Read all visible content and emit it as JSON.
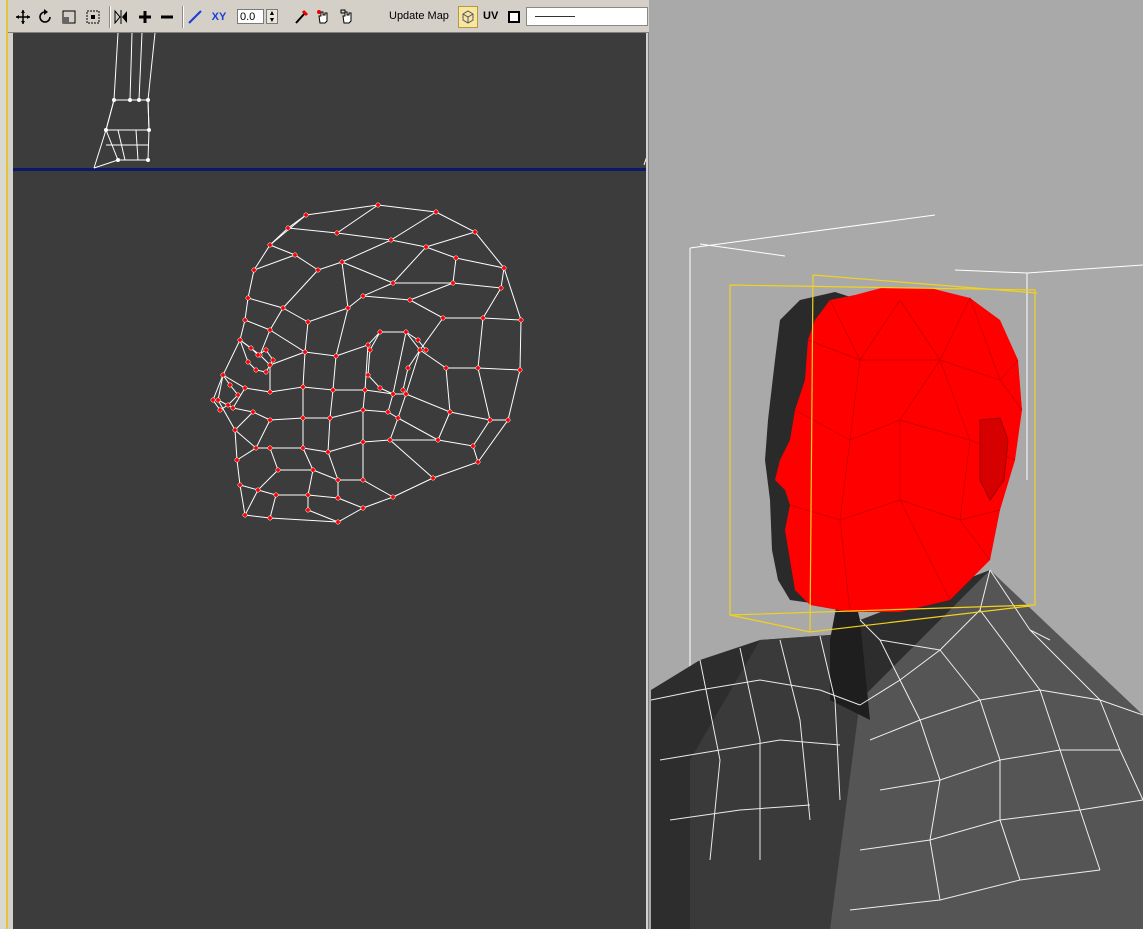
{
  "toolbar": {
    "zoom_value": "0.0",
    "update_map_label": "Update Map",
    "uv_label": "UV",
    "axis_label": "XY",
    "line_style": "solid"
  },
  "colors": {
    "uv_background": "#3c3c3c",
    "wire": "#ffffff",
    "selected_vertex": "#ff0000",
    "selected_face": "#ff0000",
    "viewport_bg": "#a9a9a9",
    "divider": "#0a1a6a",
    "gizmo": "#f2d21f"
  },
  "icons": [
    "move-icon",
    "rotate-icon",
    "scale-icon",
    "freeform-icon",
    "mirror-icon",
    "expand-icon",
    "contract-icon",
    "pen-icon",
    "axis-icon",
    "pick-icon",
    "hand-icon",
    "hand2-icon",
    "cube-icon",
    "square-icon"
  ]
}
